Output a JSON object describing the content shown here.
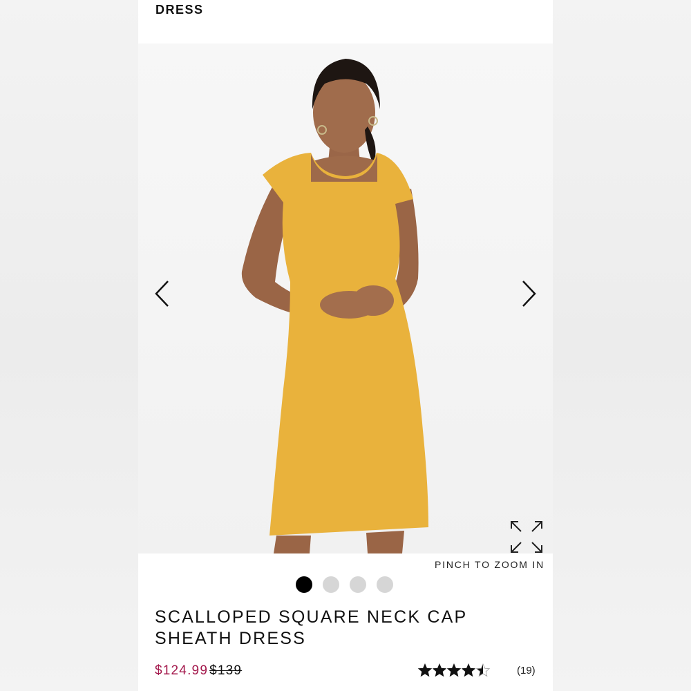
{
  "header": {
    "title": "DRESS"
  },
  "gallery": {
    "prev_icon": "chevron-left-icon",
    "next_icon": "chevron-right-icon",
    "expand_icon": "expand-icon",
    "zoom_hint": "PINCH TO ZOOM IN",
    "slides_total": 4,
    "active_slide": 1,
    "dress_color": "#E9B23C"
  },
  "product": {
    "name_line1": "SCALLOPED SQUARE NECK CAP",
    "name_line2": "SHEATH DRESS",
    "sale_price": "$124.99",
    "original_price": "$139",
    "rating": 4.5,
    "rating_max": 5,
    "review_count": "(19)"
  },
  "colors": {
    "sale_price": "#A3174B",
    "active_dot": "#000000",
    "inactive_dot": "#D6D6D6"
  }
}
